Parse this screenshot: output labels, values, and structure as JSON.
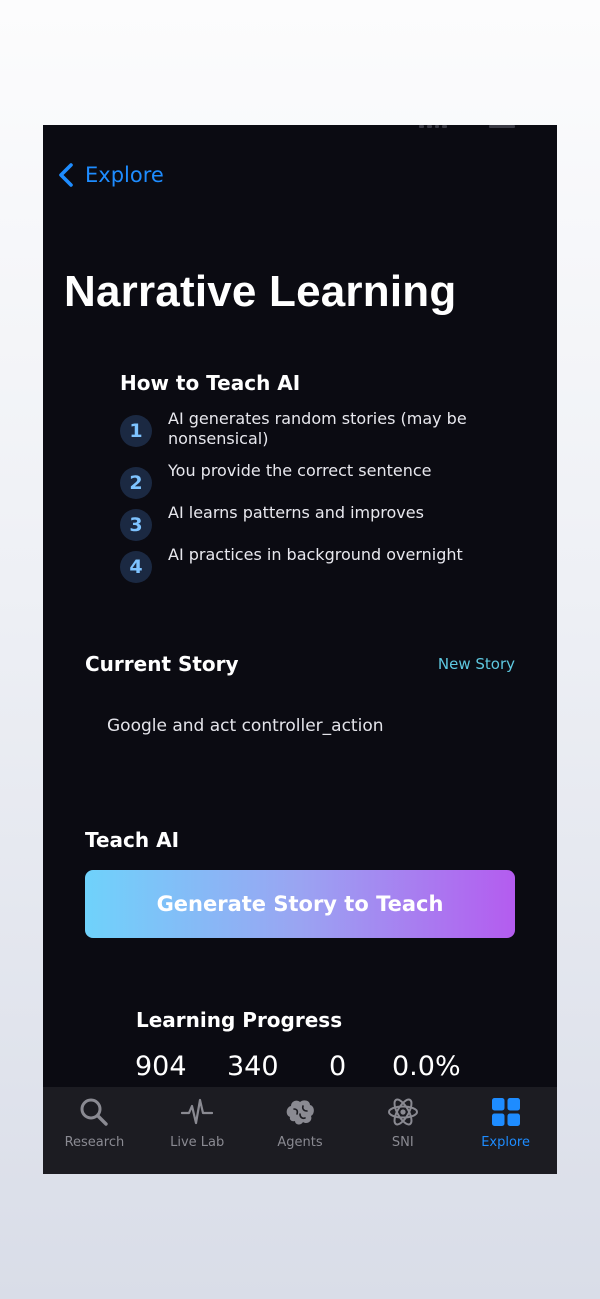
{
  "nav": {
    "back_label": "Explore"
  },
  "page": {
    "title": "Narrative Learning"
  },
  "how_to": {
    "title": "How to Teach AI",
    "steps": [
      {
        "number": "1",
        "text": "AI generates random stories (may be nonsensical)"
      },
      {
        "number": "2",
        "text": "You provide the correct sentence"
      },
      {
        "number": "3",
        "text": "AI learns patterns and improves"
      },
      {
        "number": "4",
        "text": "AI practices in background overnight"
      }
    ]
  },
  "current_story": {
    "title": "Current Story",
    "new_story_label": "New Story",
    "text": "Google and act controller_action"
  },
  "teach": {
    "title": "Teach AI",
    "button_label": "Generate Story to Teach"
  },
  "progress": {
    "title": "Learning Progress",
    "stats": [
      "904",
      "340",
      "0",
      "0.0%"
    ]
  },
  "tabbar": {
    "active": "Explore",
    "tabs": [
      {
        "label": "Research",
        "icon": "magnifier-icon"
      },
      {
        "label": "Live Lab",
        "icon": "waveform-icon"
      },
      {
        "label": "Agents",
        "icon": "brain-icon"
      },
      {
        "label": "SNI",
        "icon": "atom-icon"
      },
      {
        "label": "Explore",
        "icon": "grid-icon"
      }
    ]
  },
  "colors": {
    "background": "#0b0b12",
    "accent_blue": "#1e8cff",
    "link_teal": "#5ec8e0",
    "step_badge": "#1b2942",
    "step_number": "#7ec3ff",
    "tabbar": "#1c1c22",
    "button_gradient": [
      "#6fd2fb",
      "#9aa4f2",
      "#b45cef"
    ]
  }
}
